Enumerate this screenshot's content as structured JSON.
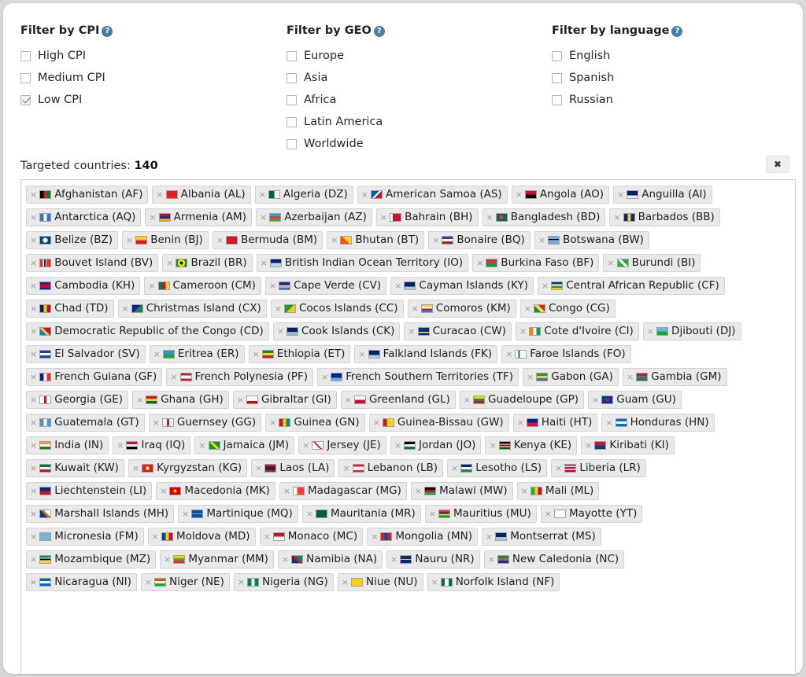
{
  "filters": {
    "cpi": {
      "title": "Filter by CPI",
      "help_icon": "question-circle-icon",
      "options": [
        {
          "label": "High CPI",
          "checked": false
        },
        {
          "label": "Medium CPI",
          "checked": false
        },
        {
          "label": "Low CPI",
          "checked": true
        }
      ]
    },
    "geo": {
      "title": "Filter by GEO",
      "help_icon": "question-circle-icon",
      "options": [
        {
          "label": "Europe",
          "checked": false
        },
        {
          "label": "Asia",
          "checked": false
        },
        {
          "label": "Africa",
          "checked": false
        },
        {
          "label": "Latin America",
          "checked": false
        },
        {
          "label": "Worldwide",
          "checked": false
        }
      ]
    },
    "language": {
      "title": "Filter by language",
      "help_icon": "question-circle-icon",
      "options": [
        {
          "label": "English",
          "checked": false
        },
        {
          "label": "Spanish",
          "checked": false
        },
        {
          "label": "Russian",
          "checked": false
        }
      ]
    }
  },
  "targeted": {
    "label": "Targeted countries:",
    "count": "140",
    "close_label": "✖",
    "remove_glyph": "×"
  },
  "colors": {
    "help_blue": "#4a7fa5",
    "tag_bg": "#e9e9e9",
    "tag_border": "#d3d3d3",
    "panel_bg": "#ffffff",
    "page_bg": "#d9d9d9"
  },
  "countries": [
    [
      {
        "name": "Afghanistan (AF)",
        "flag": "linear-gradient(90deg,#000 0 33.3%,#d32011 33.3% 66.6%,#007a36 66.6% 100%)"
      },
      {
        "name": "Albania (AL)",
        "flag": "linear-gradient(180deg,#e41e20 0 100%)"
      },
      {
        "name": "Algeria (DZ)",
        "flag": "linear-gradient(90deg,#006233 0 50%,#fff 50% 100%)"
      },
      {
        "name": "American Samoa (AS)",
        "flag": "linear-gradient(135deg,#0060af 0 45%,#fff 45% 58%,#c8102e 58% 100%)"
      },
      {
        "name": "Angola (AO)",
        "flag": "linear-gradient(180deg,#cc092f 0 50%,#000 50% 100%)"
      },
      {
        "name": "Anguilla (AI)",
        "flag": "linear-gradient(180deg,#012169 0 60%,#eee 60% 100%)"
      }
    ],
    [
      {
        "name": "Antarctica (AQ)",
        "flag": "linear-gradient(90deg,#3a75c4 0 33%,#fff 33% 66%,#3a75c4 66% 100%)"
      },
      {
        "name": "Armenia (AM)",
        "flag": "linear-gradient(180deg,#d90012 0 33.3%,#0033a0 33.3% 66.6%,#f2a800 66.6% 100%)"
      },
      {
        "name": "Azerbaijan (AZ)",
        "flag": "linear-gradient(180deg,#00b5e2 0 33.3%,#ef3340 33.3% 66.6%,#509e2f 66.6% 100%)"
      },
      {
        "name": "Bahrain (BH)",
        "flag": "linear-gradient(90deg,#fff 0 22%,#ce1126 22% 100%)"
      },
      {
        "name": "Bangladesh (BD)",
        "flag": "radial-gradient(circle at 45% 50%, #f42a41 0 32%, #006a4e 32% 100%)"
      },
      {
        "name": "Barbados (BB)",
        "flag": "linear-gradient(90deg,#00267f 0 33.3%,#ffc726 33.3% 66.6%,#00267f 66.6% 100%)"
      }
    ],
    [
      {
        "name": "Belize (BZ)",
        "flag": "radial-gradient(circle at 50% 50%, #fff 0 40%, #003f87 40% 100%)"
      },
      {
        "name": "Benin (BJ)",
        "flag": "linear-gradient(180deg,#fcd116 0 50%,#e8112d 50% 100%)"
      },
      {
        "name": "Bermuda (BM)",
        "flag": "linear-gradient(90deg,#cf142b 0 100%)"
      },
      {
        "name": "Bhutan (BT)",
        "flag": "linear-gradient(45deg,#ff4e12 0 50%,#ffd520 50% 100%)"
      },
      {
        "name": "Bonaire (BQ)",
        "flag": "linear-gradient(180deg,#21468b 0 33%,#fff 33% 66%,#ae1c28 66% 100%)"
      },
      {
        "name": "Botswana (BW)",
        "flag": "linear-gradient(180deg,#75aadb 0 35%,#000 35% 48%,#fff 48% 58%,#75aadb 58% 100%)"
      }
    ],
    [
      {
        "name": "Bouvet Island (BV)",
        "flag": "linear-gradient(90deg,#ef2b2d 0 28%,#fff 28% 38%,#002868 38% 52%,#fff 52% 62%,#ef2b2d 62% 100%)"
      },
      {
        "name": "Brazil (BR)",
        "flag": "radial-gradient(circle at 50% 50%, #002776 0 26%, #ffdf00 26% 60%, #009c3b 60% 100%)"
      },
      {
        "name": "British Indian Ocean Territory (IO)",
        "flag": "linear-gradient(180deg,#012169 0 50%,#b8d8e8 50% 100%)"
      },
      {
        "name": "Burkina Faso (BF)",
        "flag": "linear-gradient(180deg,#ef2b2d 0 50%,#009e49 50% 100%)"
      },
      {
        "name": "Burundi (BI)",
        "flag": "linear-gradient(45deg,#1eb53a 0 40%,#fff 40% 60%,#1eb53a 60% 100%)"
      }
    ],
    [
      {
        "name": "Cambodia (KH)",
        "flag": "linear-gradient(180deg,#032ea1 0 25%,#e00025 25% 75%,#032ea1 75% 100%)"
      },
      {
        "name": "Cameroon (CM)",
        "flag": "linear-gradient(90deg,#007a5e 0 33.3%,#ce1126 33.3% 66.6%,#fcd116 66.6% 100%)"
      },
      {
        "name": "Cape Verde (CV)",
        "flag": "linear-gradient(180deg,#003893 0 45%,#fff 45% 60%,#cf2027 60% 70%,#fff 70% 82%,#003893 82% 100%)"
      },
      {
        "name": "Cayman Islands (KY)",
        "flag": "linear-gradient(180deg,#012169 0 60%,#a8c8e8 60% 100%)"
      },
      {
        "name": "Central African Republic (CF)",
        "flag": "linear-gradient(180deg,#003082 0 25%,#fff 25% 50%,#289728 50% 75%,#ffce00 75% 100%)"
      }
    ],
    [
      {
        "name": "Chad (TD)",
        "flag": "linear-gradient(90deg,#002664 0 33.3%,#fecb00 33.3% 66.6%,#c60c30 66.6% 100%)"
      },
      {
        "name": "Christmas Island (CX)",
        "flag": "linear-gradient(135deg,#0021ad 0 50%,#1c8a42 50% 100%)"
      },
      {
        "name": "Cocos Islands (CC)",
        "flag": "linear-gradient(135deg,#189a43 0 50%,#ffcc00 50% 100%)"
      },
      {
        "name": "Comoros (KM)",
        "flag": "linear-gradient(180deg,#ffd100 0 25%,#fff 25% 50%,#ce1126 50% 75%,#3a75c4 75% 100%)"
      },
      {
        "name": "Congo (CG)",
        "flag": "linear-gradient(45deg,#009543 0 38%,#fbde4a 38% 62%,#dc241f 62% 100%)"
      }
    ],
    [
      {
        "name": "Democratic Republic of the Congo (CD)",
        "flag": "linear-gradient(45deg,#007fff 0 38%,#f7d518 38% 55%,#ce1021 55% 100%)"
      },
      {
        "name": "Cook Islands (CK)",
        "flag": "linear-gradient(180deg,#012169 0 55%,#9bb7d4 55% 100%)"
      },
      {
        "name": "Curacao (CW)",
        "flag": "linear-gradient(180deg,#002b7f 0 55%,#f9e814 55% 72%,#002b7f 72% 100%)"
      },
      {
        "name": "Cote d'Ivoire (CI)",
        "flag": "linear-gradient(90deg,#f77f00 0 33.3%,#fff 33.3% 66.6%,#009e60 66.6% 100%)"
      },
      {
        "name": "Djibouti (DJ)",
        "flag": "linear-gradient(180deg,#6ab2e7 0 50%,#12ad2b 50% 100%)"
      }
    ],
    [
      {
        "name": "El Salvador (SV)",
        "flag": "linear-gradient(180deg,#0f47af 0 33.3%,#fff 33.3% 66.6%,#0f47af 66.6% 100%)"
      },
      {
        "name": "Eritrea (ER)",
        "flag": "linear-gradient(180deg,#4189dd 0 50%,#12ad2b 50% 100%)"
      },
      {
        "name": "Ethiopia (ET)",
        "flag": "linear-gradient(180deg,#078930 0 33.3%,#fcdd09 33.3% 66.6%,#da121a 66.6% 100%)"
      },
      {
        "name": "Falkland Islands (FK)",
        "flag": "linear-gradient(180deg,#012169 0 60%,#b0cde8 60% 100%)"
      },
      {
        "name": "Faroe Islands (FO)",
        "flag": "linear-gradient(90deg,#fff 0 28%,#0065bd 28% 42%,#fff 42% 56%,#fff 56% 100%)"
      }
    ],
    [
      {
        "name": "French Guiana (GF)",
        "flag": "linear-gradient(90deg,#002395 0 33.3%,#fff 33.3% 66.6%,#ed2939 66.6% 100%)"
      },
      {
        "name": "French Polynesia (PF)",
        "flag": "linear-gradient(180deg,#ce1126 0 30%,#fff 30% 70%,#ce1126 70% 100%)"
      },
      {
        "name": "French Southern Territories (TF)",
        "flag": "linear-gradient(180deg,#002395 0 60%,#6fa8dc 60% 100%)"
      },
      {
        "name": "Gabon (GA)",
        "flag": "linear-gradient(180deg,#009e60 0 33.3%,#fcd116 33.3% 66.6%,#3a75c4 66.6% 100%)"
      },
      {
        "name": "Gambia (GM)",
        "flag": "linear-gradient(180deg,#ce1126 0 32%,#fff 32% 40%,#0c1c8c 40% 60%,#fff 60% 68%,#3a7728 68% 100%)"
      }
    ],
    [
      {
        "name": "Georgia (GE)",
        "flag": "linear-gradient(90deg,#fff 0 40%,#ff0000 40% 60%,#fff 60% 100%)"
      },
      {
        "name": "Ghana (GH)",
        "flag": "linear-gradient(180deg,#ce1126 0 33.3%,#fcd116 33.3% 66.6%,#006b3f 66.6% 100%)"
      },
      {
        "name": "Gibraltar (GI)",
        "flag": "linear-gradient(180deg,#fff 0 66%,#da000c 66% 100%)"
      },
      {
        "name": "Greenland (GL)",
        "flag": "linear-gradient(180deg,#fff 0 50%,#d00c33 50% 100%)"
      },
      {
        "name": "Guadeloupe (GP)",
        "flag": "linear-gradient(180deg,#ffcc00 0 35%,#009e49 35% 68%,#ce1126 68% 100%)"
      },
      {
        "name": "Guam (GU)",
        "flag": "radial-gradient(circle at 50% 50%, #b31942 0 30%, #0033a0 30% 100%)"
      }
    ],
    [
      {
        "name": "Guatemala (GT)",
        "flag": "linear-gradient(90deg,#4997d0 0 33.3%,#fff 33.3% 66.6%,#4997d0 66.6% 100%)"
      },
      {
        "name": "Guernsey (GG)",
        "flag": "linear-gradient(90deg,#fff 0 40%,#e8112d 40% 60%,#fff 60% 100%)"
      },
      {
        "name": "Guinea (GN)",
        "flag": "linear-gradient(90deg,#ce1126 0 33.3%,#fcd116 33.3% 66.6%,#009460 66.6% 100%)"
      },
      {
        "name": "Guinea-Bissau (GW)",
        "flag": "linear-gradient(90deg,#ce1126 0 35%,#fcd116 35% 100%)"
      },
      {
        "name": "Haiti (HT)",
        "flag": "linear-gradient(180deg,#00209f 0 50%,#d21034 50% 100%)"
      },
      {
        "name": "Honduras (HN)",
        "flag": "linear-gradient(180deg,#0073cf 0 33.3%,#fff 33.3% 66.6%,#0073cf 66.6% 100%)"
      }
    ],
    [
      {
        "name": "India (IN)",
        "flag": "linear-gradient(180deg,#ff9933 0 33.3%,#fff 33.3% 66.6%,#138808 66.6% 100%)"
      },
      {
        "name": "Iraq (IQ)",
        "flag": "linear-gradient(180deg,#ce1126 0 33.3%,#fff 33.3% 66.6%,#000 66.6% 100%)"
      },
      {
        "name": "Jamaica (JM)",
        "flag": "linear-gradient(45deg,#009b3a 0 40%,#fed100 40% 60%,#009b3a 60% 100%)"
      },
      {
        "name": "Jersey (JE)",
        "flag": "linear-gradient(45deg,#fff 0 44%,#e8112d 44% 56%,#fff 56% 100%)"
      },
      {
        "name": "Jordan (JO)",
        "flag": "linear-gradient(180deg,#000 0 33.3%,#fff 33.3% 66.6%,#007a3d 66.6% 100%)"
      },
      {
        "name": "Kenya (KE)",
        "flag": "linear-gradient(180deg,#000 0 30%,#fff 30% 38%,#bb0000 38% 62%,#fff 62% 70%,#006600 70% 100%)"
      },
      {
        "name": "Kiribati (KI)",
        "flag": "linear-gradient(180deg,#ce1126 0 50%,#003f87 50% 100%)"
      }
    ],
    [
      {
        "name": "Kuwait (KW)",
        "flag": "linear-gradient(180deg,#007a3d 0 33.3%,#fff 33.3% 66.6%,#ce1126 66.6% 100%)"
      },
      {
        "name": "Kyrgyzstan (KG)",
        "flag": "radial-gradient(circle at 50% 50%, #ffef00 0 32%, #e8112d 32% 100%)"
      },
      {
        "name": "Laos (LA)",
        "flag": "linear-gradient(180deg,#ce1126 0 28%,#002868 28% 72%,#ce1126 72% 100%)"
      },
      {
        "name": "Lebanon (LB)",
        "flag": "linear-gradient(180deg,#ee161f 0 25%,#fff 25% 75%,#ee161f 75% 100%)"
      },
      {
        "name": "Lesotho (LS)",
        "flag": "linear-gradient(180deg,#00209f 0 33%,#fff 33% 66%,#009543 66% 100%)"
      },
      {
        "name": "Liberia (LR)",
        "flag": "linear-gradient(180deg,#bf0a30 0 18%,#fff 18% 36%,#bf0a30 36% 54%,#fff 54% 72%,#bf0a30 72% 100%)"
      }
    ],
    [
      {
        "name": "Liechtenstein (LI)",
        "flag": "linear-gradient(180deg,#002b7f 0 50%,#ce1126 50% 100%)"
      },
      {
        "name": "Macedonia (MK)",
        "flag": "radial-gradient(circle at 50% 50%, #ffe600 0 26%, #d20000 26% 100%)"
      },
      {
        "name": "Madagascar (MG)",
        "flag": "linear-gradient(90deg,#fff 0 33%,#fc3d32 33% 100%)"
      },
      {
        "name": "Malawi (MW)",
        "flag": "linear-gradient(180deg,#000 0 33.3%,#ce1126 33.3% 66.6%,#339e35 66.6% 100%)"
      },
      {
        "name": "Mali (ML)",
        "flag": "linear-gradient(90deg,#14b53a 0 33.3%,#fcd116 33.3% 66.6%,#ce1126 66.6% 100%)"
      }
    ],
    [
      {
        "name": "Marshall Islands (MH)",
        "flag": "linear-gradient(45deg,#003893 0 45%,#dd7500 45% 62%,#fff 62% 100%)"
      },
      {
        "name": "Martinique (MQ)",
        "flag": "linear-gradient(180deg,#0050a4 0 48%,#fff 48% 54%,#0050a4 54% 100%)"
      },
      {
        "name": "Mauritania (MR)",
        "flag": "linear-gradient(180deg,#006233 0 100%)"
      },
      {
        "name": "Mauritius (MU)",
        "flag": "linear-gradient(180deg,#ea2839 0 25%,#1a206d 25% 50%,#ffd500 50% 75%,#00a551 75% 100%)"
      },
      {
        "name": "Mayotte (YT)",
        "flag": "linear-gradient(180deg,#fff 0 100%)"
      }
    ],
    [
      {
        "name": "Micronesia (FM)",
        "flag": "linear-gradient(180deg,#75b2dd 0 100%)"
      },
      {
        "name": "Moldova (MD)",
        "flag": "linear-gradient(90deg,#0046ae 0 33.3%,#ffd200 33.3% 66.6%,#cc092f 66.6% 100%)"
      },
      {
        "name": "Monaco (MC)",
        "flag": "linear-gradient(180deg,#ce1126 0 50%,#fff 50% 100%)"
      },
      {
        "name": "Mongolia (MN)",
        "flag": "linear-gradient(90deg,#c4272f 0 33.3%,#015197 33.3% 66.6%,#c4272f 66.6% 100%)"
      },
      {
        "name": "Montserrat (MS)",
        "flag": "linear-gradient(180deg,#012169 0 58%,#a8c4e0 58% 100%)"
      }
    ],
    [
      {
        "name": "Mozambique (MZ)",
        "flag": "linear-gradient(180deg,#009a44 0 30%,#fff 30% 38%,#000 38% 62%,#fff 62% 70%,#ffd100 70% 100%)"
      },
      {
        "name": "Myanmar (MM)",
        "flag": "linear-gradient(180deg,#fecb00 0 33.3%,#34b233 33.3% 66.6%,#ea2839 66.6% 100%)"
      },
      {
        "name": "Namibia (NA)",
        "flag": "linear-gradient(45deg,#003580 0 40%,#d21034 40% 58%,#009543 58% 100%)"
      },
      {
        "name": "Nauru (NR)",
        "flag": "linear-gradient(180deg,#002b7f 0 46%,#ffc61e 46% 56%,#002b7f 56% 100%)"
      },
      {
        "name": "New Caledonia (NC)",
        "flag": "linear-gradient(180deg,#009543 0 33%,#ed4135 33% 66%,#0035ad 66% 100%)"
      }
    ],
    [
      {
        "name": "Nicaragua (NI)",
        "flag": "linear-gradient(180deg,#0067c6 0 33.3%,#fff 33.3% 66.6%,#0067c6 66.6% 100%)"
      },
      {
        "name": "Niger (NE)",
        "flag": "linear-gradient(180deg,#e05206 0 33.3%,#fff 33.3% 66.6%,#0db02b 66.6% 100%)"
      },
      {
        "name": "Nigeria (NG)",
        "flag": "linear-gradient(90deg,#008751 0 33.3%,#fff 33.3% 66.6%,#008751 66.6% 100%)"
      },
      {
        "name": "Niue (NU)",
        "flag": "linear-gradient(180deg,#ffd200 0 100%)"
      },
      {
        "name": "Norfolk Island (NF)",
        "flag": "linear-gradient(90deg,#01703b 0 30%,#fff 30% 70%,#01703b 70% 100%)"
      }
    ]
  ]
}
